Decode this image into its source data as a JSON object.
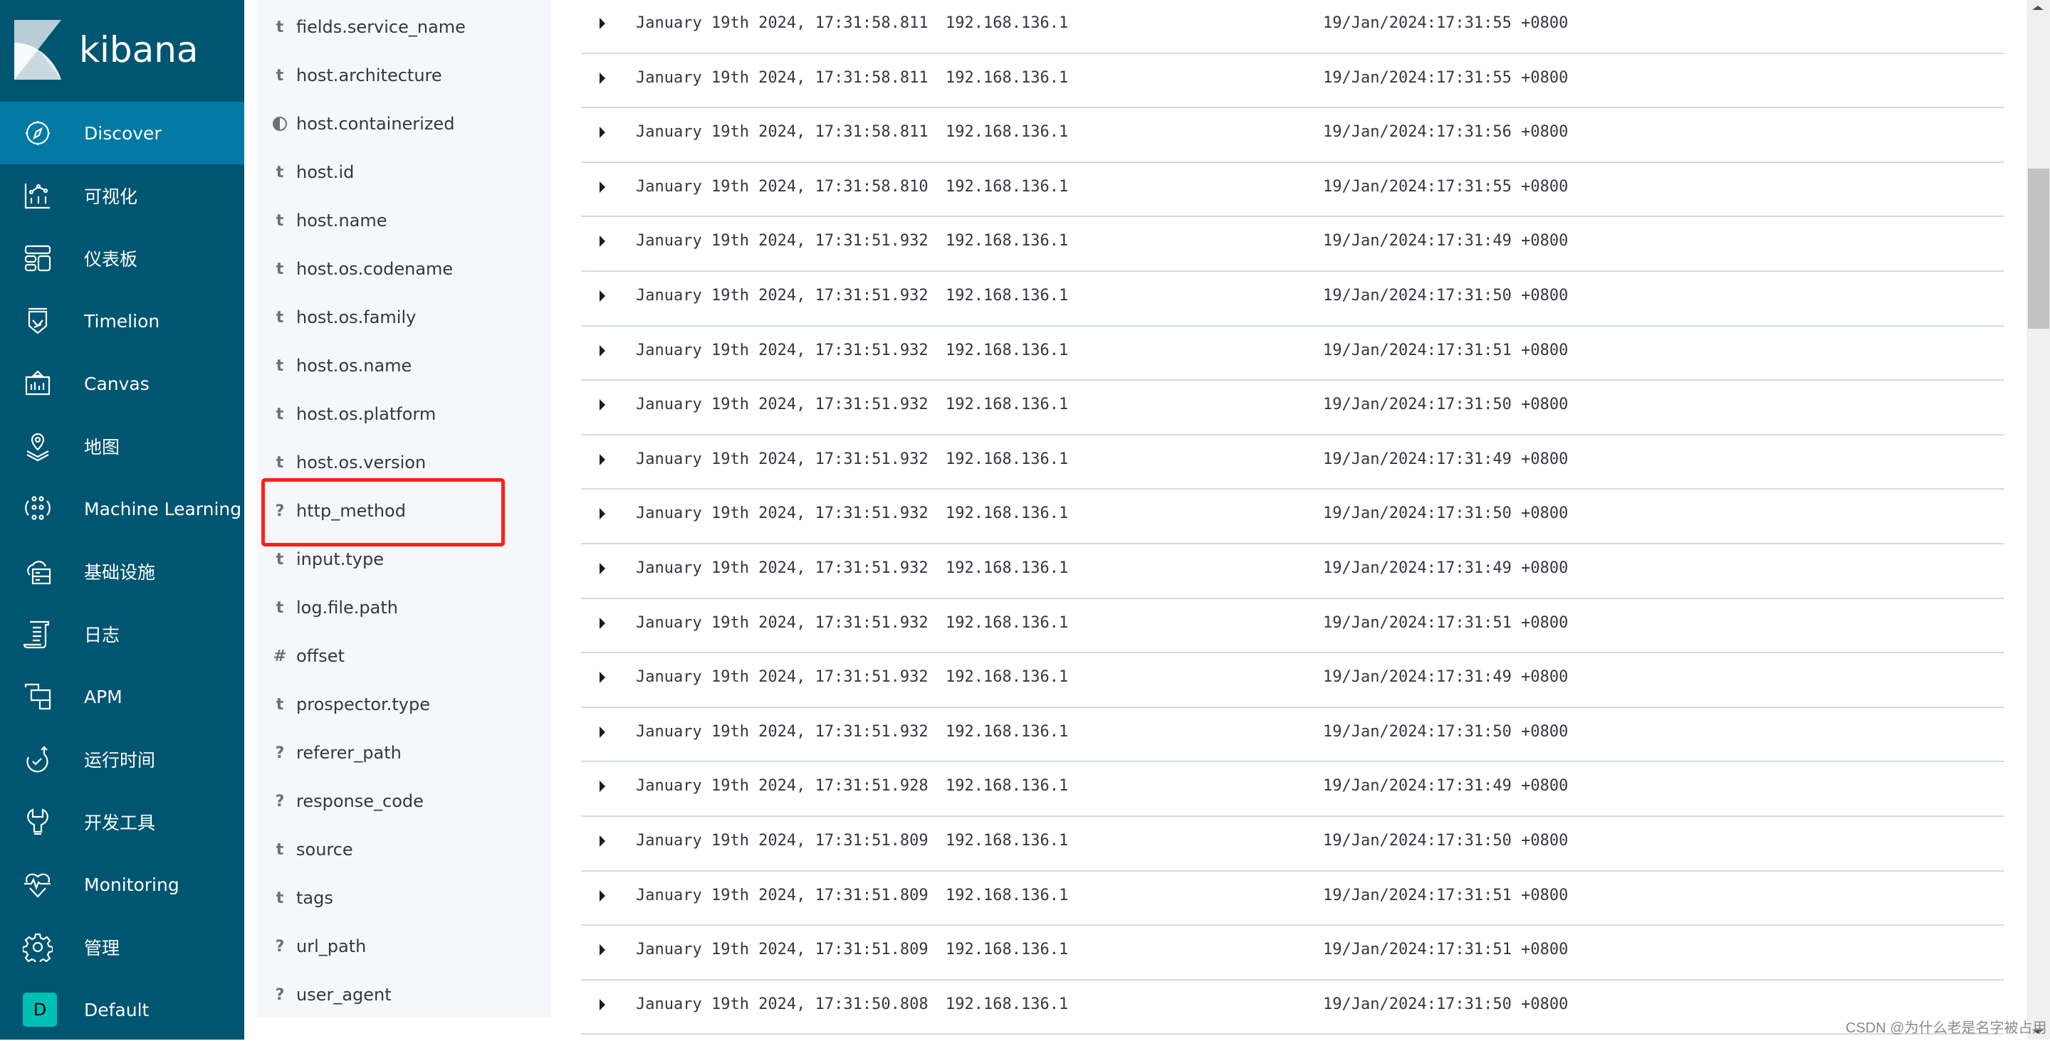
{
  "app": {
    "name": "kibana"
  },
  "colors": {
    "nav_bg": "#005571",
    "nav_active": "#0079a5",
    "field_panel_bg": "#f5f7fa",
    "highlight": "#ff1f1a",
    "space_avatar": "#00bfb3",
    "row_border": "#d3dae6"
  },
  "nav": {
    "items": [
      {
        "label": "Discover",
        "icon": "compass-icon",
        "active": true
      },
      {
        "label": "可视化",
        "icon": "visualize-icon"
      },
      {
        "label": "仪表板",
        "icon": "dashboard-icon"
      },
      {
        "label": "Timelion",
        "icon": "timelion-icon"
      },
      {
        "label": "Canvas",
        "icon": "canvas-icon"
      },
      {
        "label": "地图",
        "icon": "map-pin-icon"
      },
      {
        "label": "Machine Learning",
        "icon": "machine-learning-icon"
      },
      {
        "label": "基础设施",
        "icon": "infrastructure-icon"
      },
      {
        "label": "日志",
        "icon": "logs-icon"
      },
      {
        "label": "APM",
        "icon": "apm-icon"
      },
      {
        "label": "运行时间",
        "icon": "uptime-icon"
      },
      {
        "label": "开发工具",
        "icon": "wrench-icon"
      },
      {
        "label": "Monitoring",
        "icon": "heartbeat-icon"
      },
      {
        "label": "管理",
        "icon": "gear-icon"
      }
    ],
    "space": {
      "initial": "D",
      "label": "Default"
    }
  },
  "fields": [
    {
      "type": "t",
      "name": "fields.service_name"
    },
    {
      "type": "t",
      "name": "host.architecture"
    },
    {
      "type": "boolean",
      "name": "host.containerized"
    },
    {
      "type": "t",
      "name": "host.id"
    },
    {
      "type": "t",
      "name": "host.name"
    },
    {
      "type": "t",
      "name": "host.os.codename"
    },
    {
      "type": "t",
      "name": "host.os.family"
    },
    {
      "type": "t",
      "name": "host.os.name"
    },
    {
      "type": "t",
      "name": "host.os.platform"
    },
    {
      "type": "t",
      "name": "host.os.version"
    },
    {
      "type": "?",
      "name": "http_method",
      "highlighted": true
    },
    {
      "type": "t",
      "name": "input.type"
    },
    {
      "type": "t",
      "name": "log.file.path"
    },
    {
      "type": "#",
      "name": "offset"
    },
    {
      "type": "t",
      "name": "prospector.type"
    },
    {
      "type": "?",
      "name": "referer_path"
    },
    {
      "type": "?",
      "name": "response_code"
    },
    {
      "type": "t",
      "name": "source"
    },
    {
      "type": "t",
      "name": "tags"
    },
    {
      "type": "?",
      "name": "url_path"
    },
    {
      "type": "?",
      "name": "user_agent"
    }
  ],
  "rows": [
    {
      "time": "January 19th 2024, 17:31:58.811",
      "ip": "192.168.136.1",
      "timestamp": "19/Jan/2024:17:31:55 +0800"
    },
    {
      "time": "January 19th 2024, 17:31:58.811",
      "ip": "192.168.136.1",
      "timestamp": "19/Jan/2024:17:31:55 +0800"
    },
    {
      "time": "January 19th 2024, 17:31:58.811",
      "ip": "192.168.136.1",
      "timestamp": "19/Jan/2024:17:31:56 +0800"
    },
    {
      "time": "January 19th 2024, 17:31:58.810",
      "ip": "192.168.136.1",
      "timestamp": "19/Jan/2024:17:31:55 +0800"
    },
    {
      "time": "January 19th 2024, 17:31:51.932",
      "ip": "192.168.136.1",
      "timestamp": "19/Jan/2024:17:31:49 +0800"
    },
    {
      "time": "January 19th 2024, 17:31:51.932",
      "ip": "192.168.136.1",
      "timestamp": "19/Jan/2024:17:31:50 +0800"
    },
    {
      "time": "January 19th 2024, 17:31:51.932",
      "ip": "192.168.136.1",
      "timestamp": "19/Jan/2024:17:31:51 +0800"
    },
    {
      "time": "January 19th 2024, 17:31:51.932",
      "ip": "192.168.136.1",
      "timestamp": "19/Jan/2024:17:31:50 +0800"
    },
    {
      "time": "January 19th 2024, 17:31:51.932",
      "ip": "192.168.136.1",
      "timestamp": "19/Jan/2024:17:31:49 +0800"
    },
    {
      "time": "January 19th 2024, 17:31:51.932",
      "ip": "192.168.136.1",
      "timestamp": "19/Jan/2024:17:31:50 +0800"
    },
    {
      "time": "January 19th 2024, 17:31:51.932",
      "ip": "192.168.136.1",
      "timestamp": "19/Jan/2024:17:31:49 +0800"
    },
    {
      "time": "January 19th 2024, 17:31:51.932",
      "ip": "192.168.136.1",
      "timestamp": "19/Jan/2024:17:31:51 +0800"
    },
    {
      "time": "January 19th 2024, 17:31:51.932",
      "ip": "192.168.136.1",
      "timestamp": "19/Jan/2024:17:31:49 +0800"
    },
    {
      "time": "January 19th 2024, 17:31:51.932",
      "ip": "192.168.136.1",
      "timestamp": "19/Jan/2024:17:31:50 +0800"
    },
    {
      "time": "January 19th 2024, 17:31:51.928",
      "ip": "192.168.136.1",
      "timestamp": "19/Jan/2024:17:31:49 +0800"
    },
    {
      "time": "January 19th 2024, 17:31:51.809",
      "ip": "192.168.136.1",
      "timestamp": "19/Jan/2024:17:31:50 +0800"
    },
    {
      "time": "January 19th 2024, 17:31:51.809",
      "ip": "192.168.136.1",
      "timestamp": "19/Jan/2024:17:31:51 +0800"
    },
    {
      "time": "January 19th 2024, 17:31:51.809",
      "ip": "192.168.136.1",
      "timestamp": "19/Jan/2024:17:31:51 +0800"
    },
    {
      "time": "January 19th 2024, 17:31:50.808",
      "ip": "192.168.136.1",
      "timestamp": "19/Jan/2024:17:31:50 +0800"
    }
  ],
  "watermark": "CSDN @为什么老是名字被占用"
}
